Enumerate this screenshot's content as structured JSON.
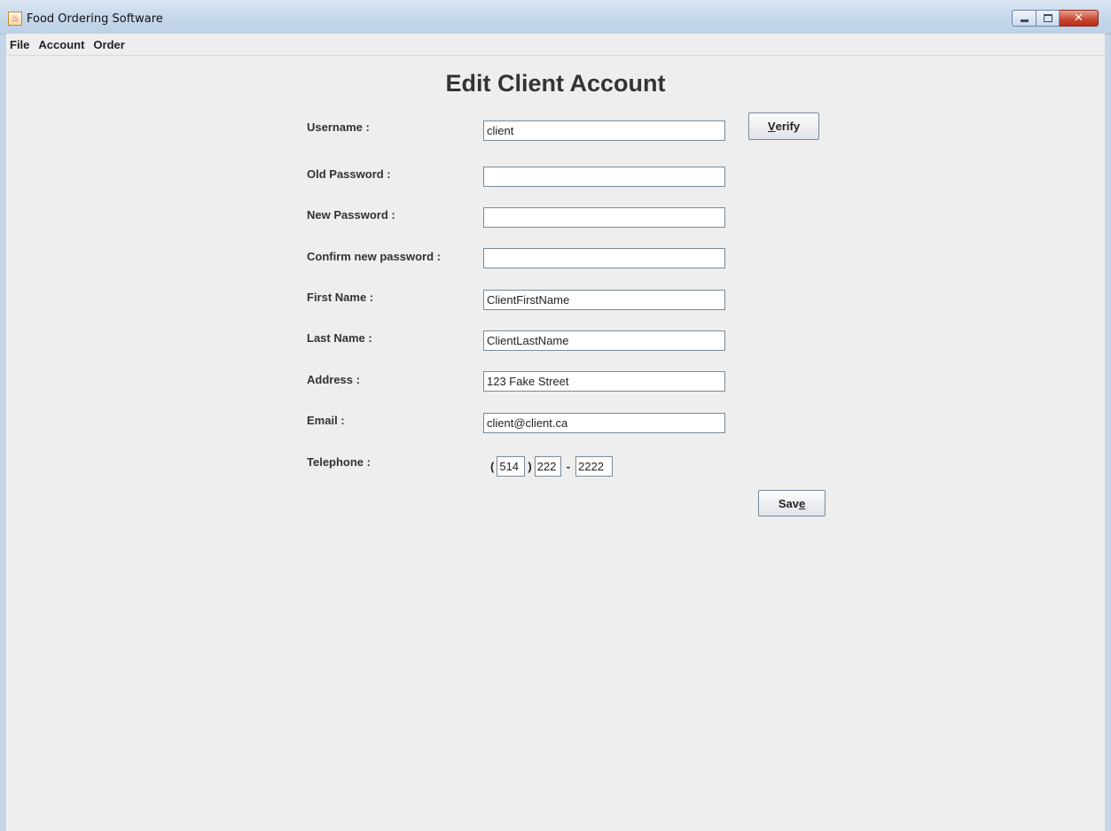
{
  "window": {
    "title": "Food Ordering Software",
    "icon": "java-cup-icon"
  },
  "menu": [
    "File",
    "Account",
    "Order"
  ],
  "form": {
    "heading": "Edit Client Account",
    "fields": {
      "username": {
        "label": "Username :",
        "value": "client"
      },
      "old_password": {
        "label": "Old Password :",
        "value": ""
      },
      "new_password": {
        "label": "New Password :",
        "value": ""
      },
      "confirm_password": {
        "label": "Confirm new password :",
        "value": ""
      },
      "first_name": {
        "label": "First Name :",
        "value": "ClientFirstName"
      },
      "last_name": {
        "label": "Last Name :",
        "value": "ClientLastName"
      },
      "address": {
        "label": "Address :",
        "value": "123 Fake Street"
      },
      "email": {
        "label": "Email :",
        "value": "client@client.ca"
      }
    },
    "telephone": {
      "label": "Telephone :",
      "open": "(",
      "close": ")",
      "dash": "-",
      "area": "514",
      "prefix": "222",
      "line": "2222"
    },
    "verify": {
      "mnemonic": "V",
      "rest": "erify"
    },
    "save": {
      "before": "Sav",
      "mnemonic": "e"
    }
  }
}
